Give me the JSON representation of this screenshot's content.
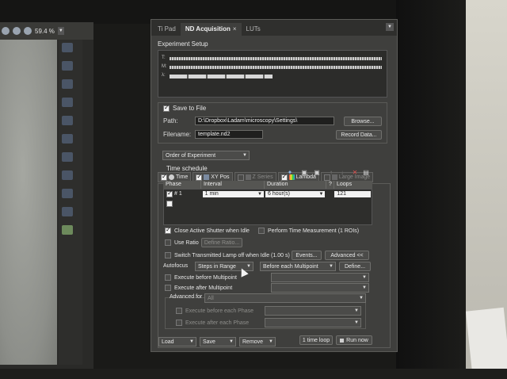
{
  "left_app": {
    "zoom_value": "59.4 %"
  },
  "panel": {
    "tabs": [
      {
        "label": "Ti Pad"
      },
      {
        "label": "ND Acquisition"
      },
      {
        "label": "LUTs"
      }
    ],
    "tab_close_glyph": "×",
    "experiment_setup_title": "Experiment Setup",
    "timeline_labels": [
      "T:",
      "M:",
      "λ:"
    ],
    "save_to_file": {
      "label": "Save to File",
      "checked": true,
      "path_label": "Path:",
      "path_value": "D:\\Dropbox\\Ladam\\microscopy\\Settings\\",
      "browse_label": "Browse...",
      "filename_label": "Filename:",
      "filename_value": "template.nd2",
      "record_data_label": "Record Data..."
    },
    "order_combo_value": "Order of Experiment",
    "dimension_tabs": [
      {
        "label": "Time",
        "checked": true,
        "icon": "clock-icon"
      },
      {
        "label": "XY Pos",
        "checked": true,
        "icon": "grid-icon"
      },
      {
        "label": "Z Series",
        "checked": false,
        "icon": "z-stack-icon"
      },
      {
        "label": "Lambda",
        "checked": true,
        "icon": "rainbow-icon"
      },
      {
        "label": "Large Image",
        "checked": false,
        "icon": "large-image-icon"
      }
    ],
    "time_schedule": {
      "title": "Time schedule",
      "columns": [
        "Phase",
        "Interval",
        "Duration",
        "?",
        "Loops"
      ],
      "rows": [
        {
          "phase": "# 1",
          "interval": "1 min",
          "duration": "6 hour(s)",
          "loops": "121"
        }
      ]
    },
    "options": {
      "close_shutter": "Close Active Shutter when Idle",
      "perform_time_measurement": "Perform Time Measurement (1 ROIs)",
      "use_ratio": "Use Ratio",
      "define_ratio": "Define Ratio...",
      "switch_lamp": "Switch Transmitted Lamp off when Idle (1.00 s)",
      "events": "Events...",
      "advanced_toggle": "Advanced <<",
      "autofocus_label": "Autofocus",
      "autofocus_mode": "Steps in Range",
      "autofocus_when": "Before each Multipoint",
      "define": "Define...",
      "execute_before_multipoint": "Execute before Multipoint",
      "execute_after_multipoint": "Execute after Multipoint",
      "advanced_for_label": "Advanced for",
      "advanced_for_value": "All",
      "execute_before_each_phase": "Execute before each Phase",
      "execute_after_each_phase": "Execute after each Phase"
    },
    "bottom": {
      "load": "Load",
      "save": "Save",
      "remove": "Remove",
      "one_time_loop": "1 time loop",
      "run_now": "Run now"
    }
  }
}
